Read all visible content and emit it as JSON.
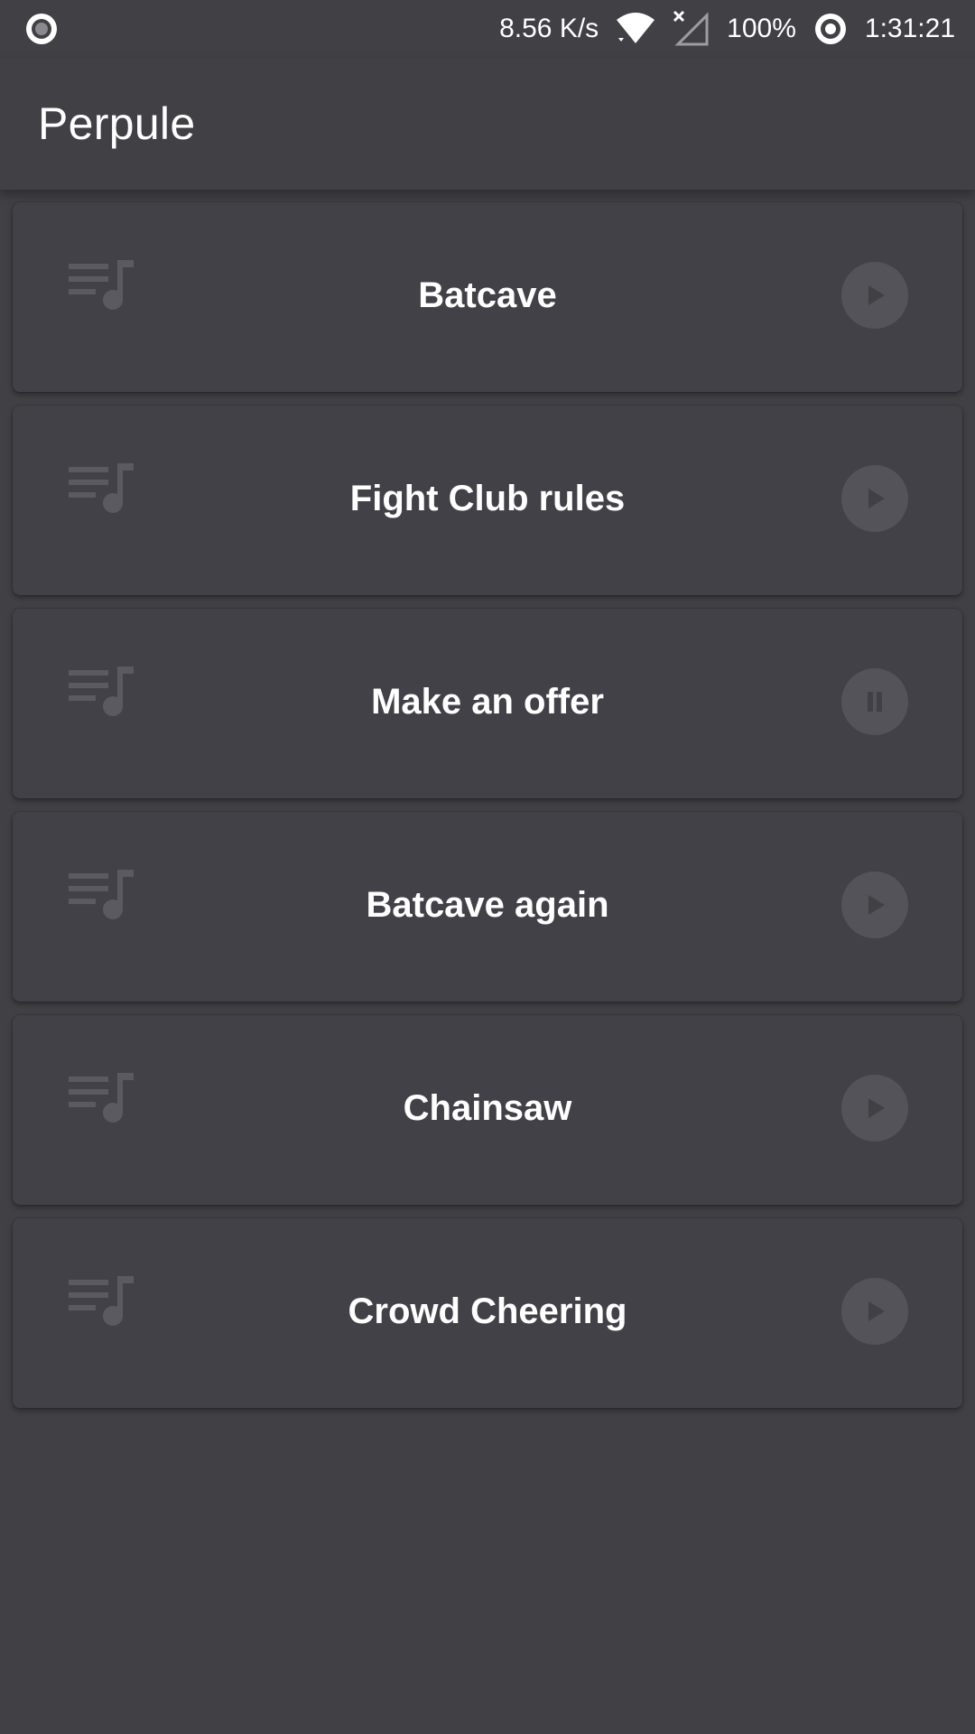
{
  "status_bar": {
    "network_speed": "8.56 K/s",
    "battery": "100%",
    "time": "1:31:21",
    "icons": [
      "record-icon",
      "wifi-icon",
      "no-signal-icon",
      "hotspot-icon"
    ]
  },
  "app_bar": {
    "title": "Perpule"
  },
  "colors": {
    "background": "#414045",
    "card": "#424147",
    "action_circle": "#54535a",
    "icon_muted": "#5b5a60"
  },
  "tracks": [
    {
      "title": "Batcave",
      "state": "play",
      "icon": "queue-music-icon",
      "action_icon": "play-icon"
    },
    {
      "title": "Fight Club rules",
      "state": "play",
      "icon": "queue-music-icon",
      "action_icon": "play-icon"
    },
    {
      "title": "Make an offer",
      "state": "pause",
      "icon": "queue-music-icon",
      "action_icon": "pause-icon"
    },
    {
      "title": "Batcave again",
      "state": "play",
      "icon": "queue-music-icon",
      "action_icon": "play-icon"
    },
    {
      "title": "Chainsaw",
      "state": "play",
      "icon": "queue-music-icon",
      "action_icon": "play-icon"
    },
    {
      "title": "Crowd Cheering",
      "state": "play",
      "icon": "queue-music-icon",
      "action_icon": "play-icon"
    }
  ]
}
